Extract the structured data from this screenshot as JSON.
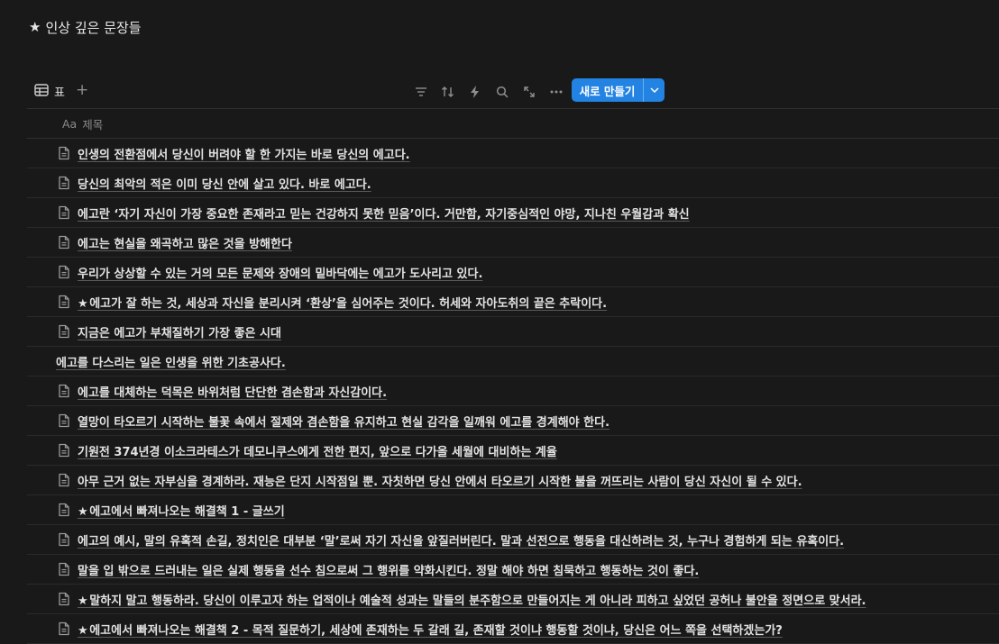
{
  "page": {
    "title": "인상 깊은 문장들"
  },
  "toolbar": {
    "view_label": "표",
    "add_view": "+",
    "new_label": "새로 만들기",
    "tools": [
      "filter-icon",
      "sort-icon",
      "lightning-icon",
      "search-icon",
      "expand-icon",
      "more-icon"
    ]
  },
  "table": {
    "column_prefix": "Aa",
    "column_title": "제목",
    "rows": [
      {
        "text": "인생의 전환점에서 당신이 버려야 할 한 가지는 바로 당신의 에고다.",
        "star": false,
        "icon": true
      },
      {
        "text": "당신의 최악의 적은 이미 당신 안에 살고 있다. 바로 에고다.",
        "star": false,
        "icon": true
      },
      {
        "text": "에고란 ‘자기 자신이 가장 중요한 존재라고 믿는 건강하지 못한 믿음’이다. 거만함, 자기중심적인 야망, 지나친 우월감과 확신",
        "star": false,
        "icon": true
      },
      {
        "text": "에고는 현실을 왜곡하고 많은 것을 방해한다",
        "star": false,
        "icon": true
      },
      {
        "text": "우리가 상상할 수 있는 거의 모든 문제와 장애의 밑바닥에는 에고가 도사리고 있다.",
        "star": false,
        "icon": true
      },
      {
        "text": "에고가 잘 하는 것, 세상과 자신을 분리시켜 ‘환상’을 심어주는 것이다. 허세와 자아도취의 끝은 추락이다.",
        "star": true,
        "icon": true
      },
      {
        "text": "지금은 에고가 부채질하기 가장 좋은 시대",
        "star": false,
        "icon": true
      },
      {
        "text": "에고를 다스리는 일은 인생을 위한 기초공사다.",
        "star": false,
        "icon": false
      },
      {
        "text": "에고를 대체하는 덕목은 바위처럼 단단한 겸손함과 자신감이다.",
        "star": false,
        "icon": true
      },
      {
        "text": "열망이 타오르기 시작하는 불꽃 속에서 절제와 겸손함을 유지하고 현실 감각을 일깨워 에고를 경계해야 한다.",
        "star": false,
        "icon": true
      },
      {
        "text": "기원전 374년경 이소크라테스가 데모니쿠스에게 전한 편지, 앞으로 다가올 세월에 대비하는 계율",
        "star": false,
        "icon": true
      },
      {
        "text": "아무 근거 없는 자부심을 경계하라. 재능은 단지 시작점일 뿐. 자칫하면 당신 안에서 타오르기 시작한 불을 꺼뜨리는 사람이 당신 자신이 될 수 있다.",
        "star": false,
        "icon": true
      },
      {
        "text": "에고에서 빠져나오는 해결책 1 - 글쓰기",
        "star": true,
        "icon": true
      },
      {
        "text": "에고의 예시, 말의 유혹적 손길, 정치인은 대부분 ‘말’로써 자기 자신을 앞질러버린다. 말과 선전으로 행동을 대신하려는 것, 누구나 경험하게 되는 유혹이다.",
        "star": false,
        "icon": true
      },
      {
        "text": "말을 입 밖으로 드러내는 일은 실제 행동을 선수 침으로써 그 행위를 약화시킨다. 정말 해야 하면 침묵하고 행동하는 것이 좋다.",
        "star": false,
        "icon": true
      },
      {
        "text": "말하지 말고 행동하라. 당신이 이루고자 하는 업적이나 예술적 성과는 말들의 분주함으로 만들어지는 게 아니라 피하고 싶었던 공허나 불안을 정면으로 맞서라.",
        "star": true,
        "icon": true
      },
      {
        "text": "에고에서 빠져나오는 해결책 2 - 목적 질문하기, 세상에 존재하는 두 갈래 길, 존재할 것이냐 행동할 것이냐, 당신은 어느 쪽을 선택하겠는가?",
        "star": true,
        "icon": true
      }
    ]
  }
}
